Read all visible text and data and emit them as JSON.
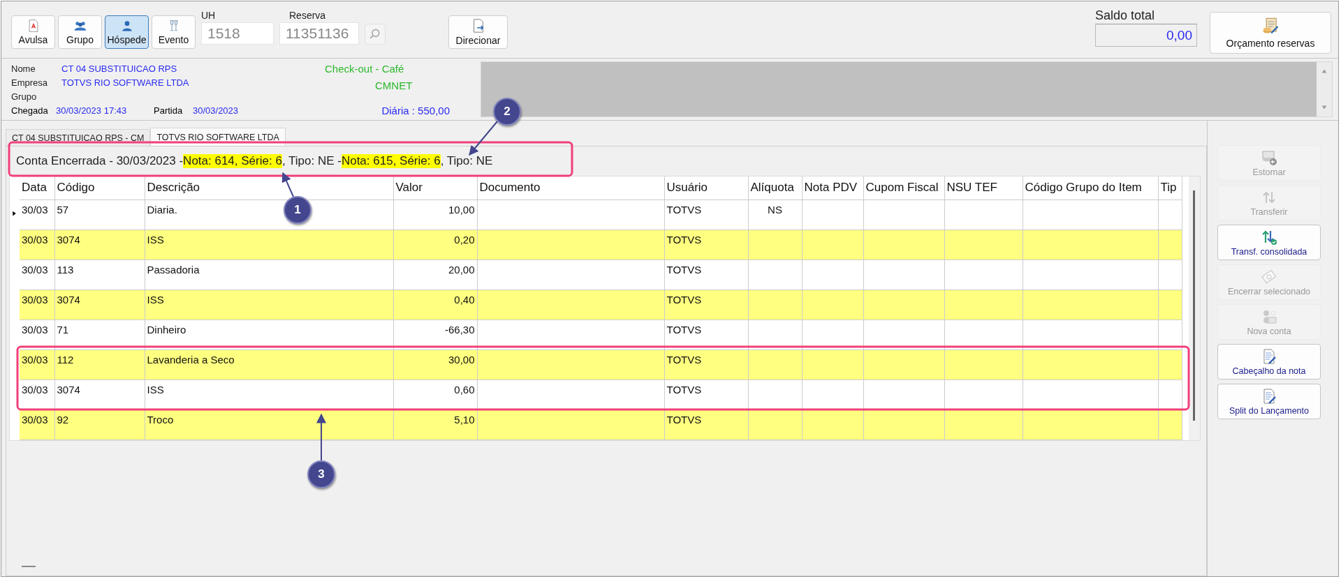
{
  "toolbar": {
    "mode_buttons": [
      {
        "label": "Avulsa",
        "selected": false
      },
      {
        "label": "Grupo",
        "selected": false
      },
      {
        "label": "Hóspede",
        "selected": true
      },
      {
        "label": "Evento",
        "selected": false
      }
    ],
    "uh": {
      "label": "UH",
      "value": "1518"
    },
    "reserva": {
      "label": "Reserva",
      "value": "11351136"
    },
    "direcionar": "Direcionar",
    "saldo": {
      "label": "Saldo total",
      "value": "0,00"
    },
    "orcamento": "Orçamento reservas"
  },
  "guest": {
    "nome_label": "Nome",
    "nome": "CT 04 SUBSTITUICAO RPS",
    "empresa_label": "Empresa",
    "empresa": "TOTVS RIO SOFTWARE LTDA",
    "grupo_label": "Grupo",
    "chegada_label": "Chegada",
    "chegada": "30/03/2023 17:43",
    "partida_label": "Partida",
    "partida": "30/03/2023",
    "status": "Check-out -  Café",
    "origin": "CMNET",
    "diaria": "Diária : 550,00"
  },
  "tabs": [
    {
      "label": "CT 04 SUBSTITUICAO RPS - CM",
      "selected": false
    },
    {
      "label": "TOTVS RIO SOFTWARE LTDA",
      "selected": true
    }
  ],
  "account_status": [
    {
      "text": "Conta Encerrada - 30/03/2023 - ",
      "highlighted": false
    },
    {
      "text": "Nota: 614, Série: 6",
      "highlighted": true
    },
    {
      "text": ", Tipo: NE - ",
      "highlighted": false
    },
    {
      "text": "Nota: 615, Série: 6",
      "highlighted": true
    },
    {
      "text": ", Tipo: NE",
      "highlighted": false
    }
  ],
  "table": {
    "columns": [
      "Data",
      "Código",
      "Descrição",
      "Valor",
      "Documento",
      "Usuário",
      "Alíquota",
      "Nota PDV",
      "Cupom Fiscal",
      "NSU TEF",
      "Código Grupo do Item",
      "Tip"
    ],
    "rows": [
      {
        "current": true,
        "highlighted": false,
        "data": "30/03",
        "codigo": "57",
        "descricao": "Diaria.",
        "valor": "10,00",
        "usuario": "TOTVS",
        "aliquota": "NS"
      },
      {
        "current": false,
        "highlighted": true,
        "data": "30/03",
        "codigo": "3074",
        "descricao": "ISS",
        "valor": "0,20",
        "usuario": "TOTVS"
      },
      {
        "current": false,
        "highlighted": false,
        "data": "30/03",
        "codigo": "113",
        "descricao": "Passadoria",
        "valor": "20,00",
        "usuario": "TOTVS"
      },
      {
        "current": false,
        "highlighted": true,
        "data": "30/03",
        "codigo": "3074",
        "descricao": "ISS",
        "valor": "0,40",
        "usuario": "TOTVS"
      },
      {
        "current": false,
        "highlighted": false,
        "data": "30/03",
        "codigo": "71",
        "descricao": "Dinheiro",
        "valor": "-66,30",
        "usuario": "TOTVS"
      },
      {
        "current": false,
        "highlighted": true,
        "data": "30/03",
        "codigo": "112",
        "descricao": "Lavanderia a Seco",
        "valor": "30,00",
        "usuario": "TOTVS"
      },
      {
        "current": false,
        "highlighted": false,
        "data": "30/03",
        "codigo": "3074",
        "descricao": "ISS",
        "valor": "0,60",
        "usuario": "TOTVS"
      },
      {
        "current": false,
        "highlighted": true,
        "data": "30/03",
        "codigo": "92",
        "descricao": "Troco",
        "valor": "5,10",
        "usuario": "TOTVS"
      }
    ]
  },
  "side_buttons": [
    {
      "label": "Estornar",
      "disabled": true
    },
    {
      "label": "Transferir",
      "disabled": true
    },
    {
      "label": "Transf. consolidada",
      "disabled": false
    },
    {
      "label": "Encerrar selecionado",
      "disabled": true
    },
    {
      "label": "Nova conta",
      "disabled": true
    },
    {
      "label": "Cabeçalho da nota",
      "disabled": false
    },
    {
      "label": "Split do Lançamento",
      "disabled": false
    }
  ],
  "annotations": [
    {
      "number": "1"
    },
    {
      "number": "2"
    },
    {
      "number": "3"
    }
  ]
}
